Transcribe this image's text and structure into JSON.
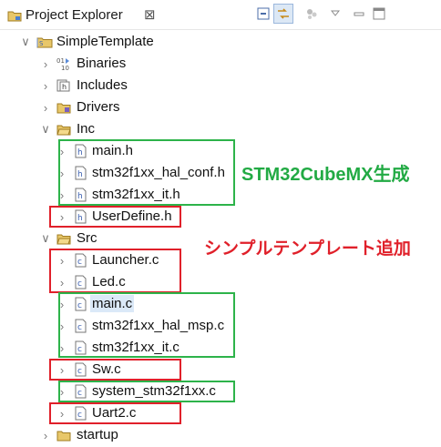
{
  "view": {
    "title": "Project Explorer",
    "close_glyph": "⊠",
    "toolbar": [
      "collapse-all-icon",
      "link-with-editor-icon",
      "filter-icon",
      "view-menu-icon",
      "minimize-icon",
      "maximize-icon"
    ]
  },
  "tree": {
    "root": "SimpleTemplate",
    "items": {
      "binaries": "Binaries",
      "includes": "Includes",
      "drivers": "Drivers",
      "inc": "Inc",
      "inc_main_h": "main.h",
      "inc_hal_conf_h": "stm32f1xx_hal_conf.h",
      "inc_it_h": "stm32f1xx_it.h",
      "inc_userdefine_h": "UserDefine.h",
      "src": "Src",
      "src_launcher_c": "Launcher.c",
      "src_led_c": "Led.c",
      "src_main_c": "main.c",
      "src_hal_msp_c": "stm32f1xx_hal_msp.c",
      "src_it_c": "stm32f1xx_it.c",
      "src_sw_c": "Sw.c",
      "src_system_c": "system_stm32f1xx.c",
      "src_uart2_c": "Uart2.c",
      "startup": "startup"
    }
  },
  "annotations": {
    "generated": {
      "text": "STM32CubeMX生成",
      "color": "#22aa44"
    },
    "added": {
      "text": "シンプルテンプレート追加",
      "color": "#e0202a"
    }
  },
  "colors": {
    "green_box": "#2db34a",
    "red_box": "#e0202a",
    "selection": "#dbe9f8"
  }
}
